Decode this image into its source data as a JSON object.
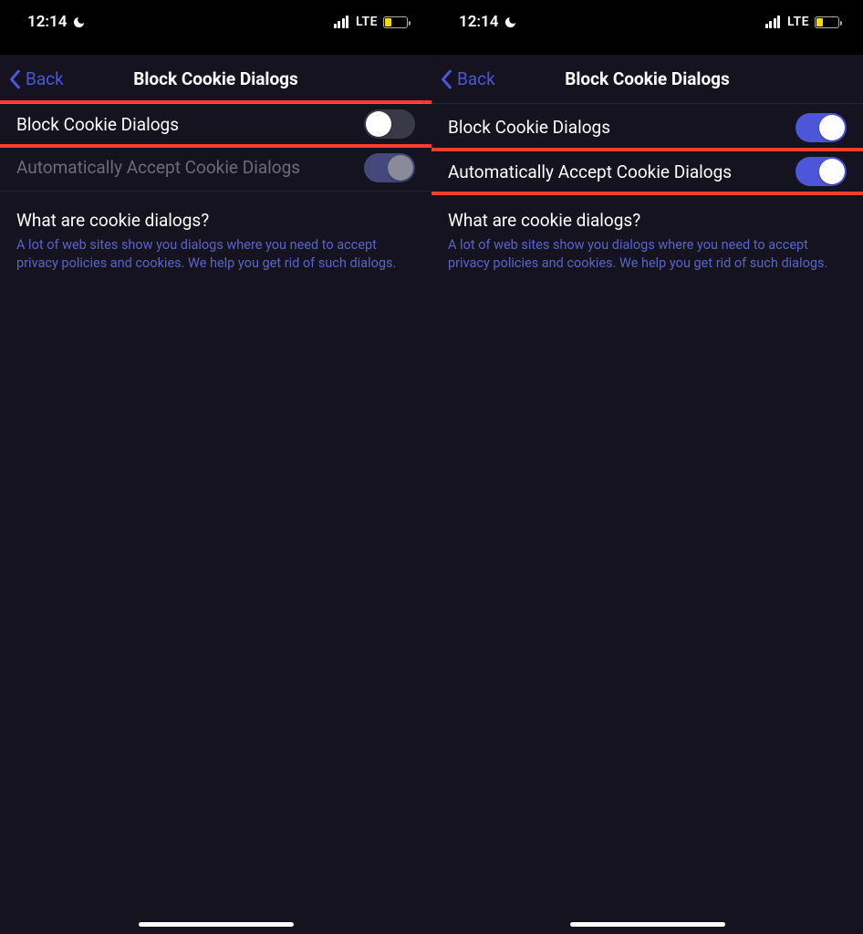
{
  "status": {
    "time": "12:14",
    "network": "LTE"
  },
  "nav": {
    "back": "Back",
    "title": "Block Cookie Dialogs"
  },
  "rows": {
    "block": "Block Cookie Dialogs",
    "auto": "Automatically Accept Cookie Dialogs"
  },
  "info": {
    "title": "What are cookie dialogs?",
    "body": "A lot of web sites show you dialogs where you need to accept privacy policies and cookies. We help you get rid of such dialogs."
  }
}
